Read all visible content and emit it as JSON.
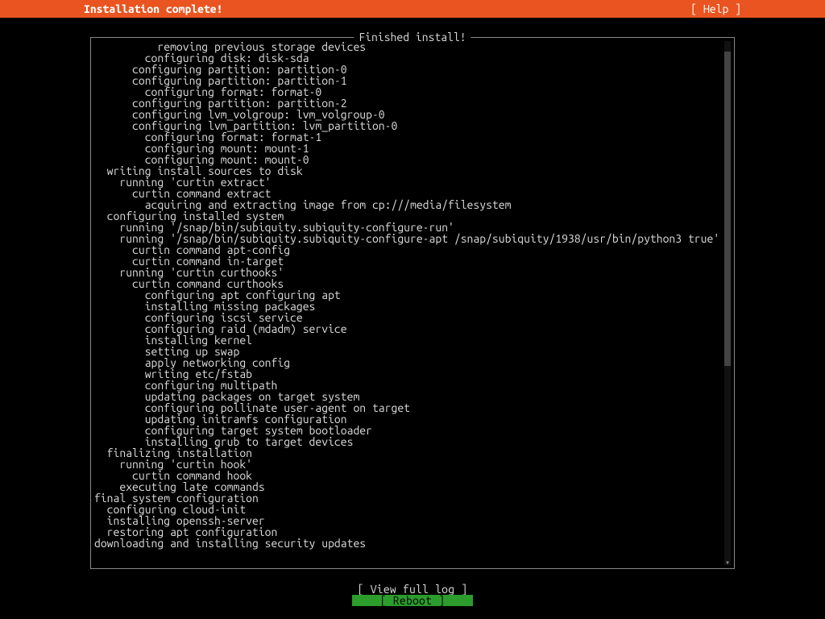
{
  "header": {
    "title": "Installation complete!",
    "help": "[ Help ]"
  },
  "panel": {
    "title": " Finished install! "
  },
  "log": {
    "lines": [
      "          removing previous storage devices",
      "        configuring disk: disk-sda",
      "      configuring partition: partition-0",
      "      configuring partition: partition-1",
      "        configuring format: format-0",
      "      configuring partition: partition-2",
      "      configuring lvm_volgroup: lvm_volgroup-0",
      "      configuring lvm_partition: lvm_partition-0",
      "        configuring format: format-1",
      "        configuring mount: mount-1",
      "        configuring mount: mount-0",
      "  writing install sources to disk",
      "    running 'curtin extract'",
      "      curtin command extract",
      "        acquiring and extracting image from cp:///media/filesystem",
      "  configuring installed system",
      "    running '/snap/bin/subiquity.subiquity-configure-run'",
      "    running '/snap/bin/subiquity.subiquity-configure-apt /snap/subiquity/1938/usr/bin/python3 true'",
      "      curtin command apt-config",
      "      curtin command in-target",
      "    running 'curtin curthooks'",
      "      curtin command curthooks",
      "        configuring apt configuring apt",
      "        installing missing packages",
      "        configuring iscsi service",
      "        configuring raid (mdadm) service",
      "        installing kernel",
      "        setting up swap",
      "        apply networking config",
      "        writing etc/fstab",
      "        configuring multipath",
      "        updating packages on target system",
      "        configuring pollinate user-agent on target",
      "        updating initramfs configuration",
      "        configuring target system bootloader",
      "        installing grub to target devices",
      "  finalizing installation",
      "    running 'curtin hook'",
      "      curtin command hook",
      "    executing late commands",
      "final system configuration",
      "  configuring cloud-init",
      "  installing openssh-server",
      "  restoring apt configuration",
      "downloading and installing security updates"
    ]
  },
  "buttons": {
    "view_full_log": "[ View full log ]",
    "reboot": "[ Reboot        ]"
  }
}
